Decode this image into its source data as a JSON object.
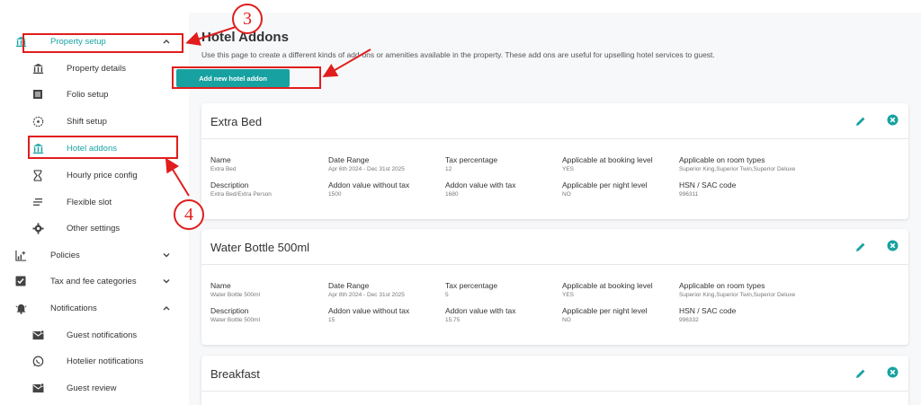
{
  "sidebar": {
    "items": [
      {
        "label": "Property setup",
        "icon": "bank-icon"
      },
      {
        "label": "Property details",
        "icon": "bank-icon"
      },
      {
        "label": "Folio setup",
        "icon": "document-icon"
      },
      {
        "label": "Shift setup",
        "icon": "clock-icon"
      },
      {
        "label": "Hotel addons",
        "icon": "bank-icon"
      },
      {
        "label": "Hourly price config",
        "icon": "hourglass-icon"
      },
      {
        "label": "Flexible slot",
        "icon": "lines-icon"
      },
      {
        "label": "Other settings",
        "icon": "gear-icon"
      },
      {
        "label": "Policies",
        "icon": "chart-icon"
      },
      {
        "label": "Tax and fee categories",
        "icon": "checkbox-icon"
      },
      {
        "label": "Notifications",
        "icon": "bell-icon"
      },
      {
        "label": "Guest notifications",
        "icon": "mail-icon"
      },
      {
        "label": "Hotelier notifications",
        "icon": "whatsapp-icon"
      },
      {
        "label": "Guest review",
        "icon": "mail-icon"
      }
    ]
  },
  "annotations": {
    "three": "3",
    "four": "4"
  },
  "header": {
    "title": "Hotel Addons",
    "description": "Use this page to create a different kinds of add-ons or amenities available in the property. These add ons are useful for upselling hotel services to guest.",
    "add_button": "Add new hotel addon"
  },
  "labels": {
    "name": "Name",
    "date_range": "Date Range",
    "tax_percentage": "Tax percentage",
    "booking_level": "Applicable at booking level",
    "room_types": "Applicable on room types",
    "description": "Description",
    "value_without_tax": "Addon value without tax",
    "value_with_tax": "Addon value with tax",
    "per_night": "Applicable per night level",
    "hsn": "HSN / SAC code"
  },
  "addons": [
    {
      "title": "Extra Bed",
      "name": "Extra Bed",
      "date_range": "Apr 6th 2024 - Dec 31st 2025",
      "tax_percentage": "12",
      "booking_level": "YES",
      "room_types": "Superior King,Superior Twin,Superior Deluxe",
      "description": "Extra Bed/Extra Person",
      "value_without_tax": "1500",
      "value_with_tax": "1680",
      "per_night": "NO",
      "hsn": "996311"
    },
    {
      "title": "Water Bottle 500ml",
      "name": "Water Bottle 500ml",
      "date_range": "Apr 8th 2024 - Dec 31st 2025",
      "tax_percentage": "5",
      "booking_level": "YES",
      "room_types": "Superior King,Superior Twin,Superior Deluxe",
      "description": "Water Bottle 500ml",
      "value_without_tax": "15",
      "value_with_tax": "15.75",
      "per_night": "NO",
      "hsn": "996332"
    },
    {
      "title": "Breakfast"
    }
  ],
  "colors": {
    "accent": "#17a2a1",
    "annotation": "#e11d1d"
  }
}
